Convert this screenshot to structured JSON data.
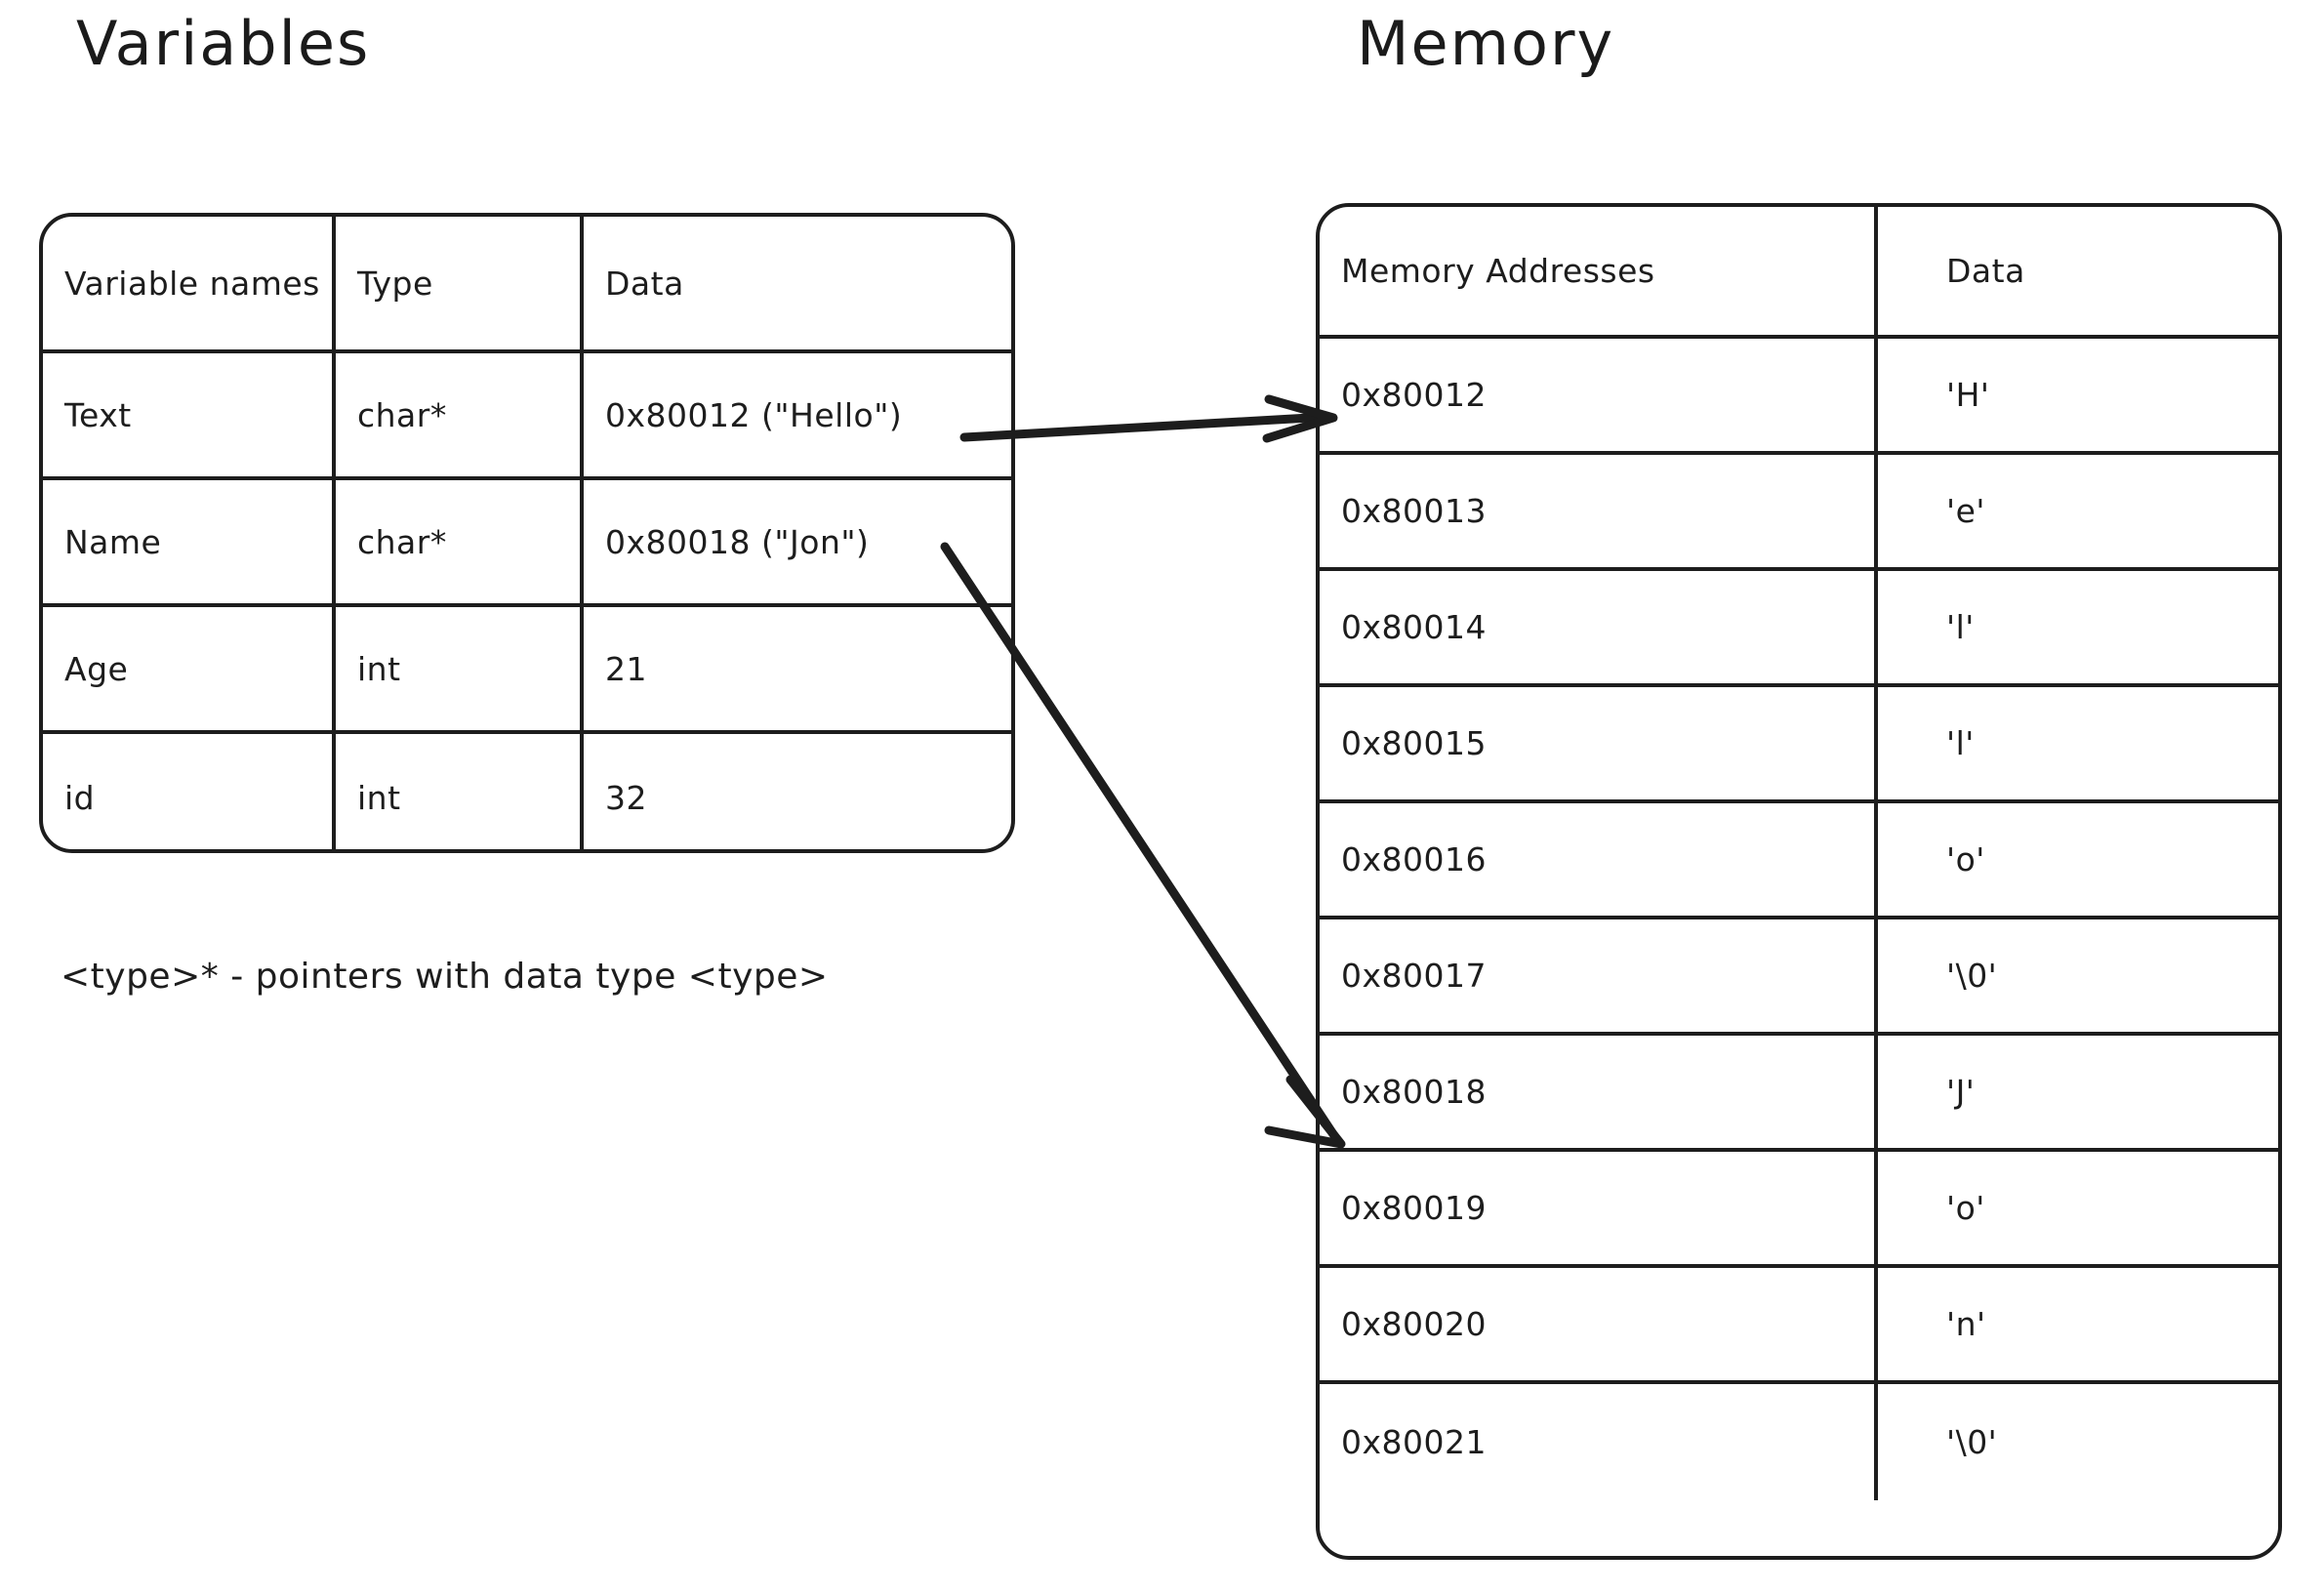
{
  "sections": {
    "variables_title": "Variables",
    "memory_title": "Memory"
  },
  "variables_table": {
    "headers": {
      "name": "Variable names",
      "type": "Type",
      "data": "Data"
    },
    "rows": [
      {
        "name": "Text",
        "type": "char*",
        "data": "0x80012 (\"Hello\")"
      },
      {
        "name": "Name",
        "type": "char*",
        "data": "0x80018 (\"Jon\")"
      },
      {
        "name": "Age",
        "type": "int",
        "data": "21"
      },
      {
        "name": "id",
        "type": "int",
        "data": "32"
      }
    ]
  },
  "memory_table": {
    "headers": {
      "address": "Memory Addresses",
      "data": "Data"
    },
    "rows": [
      {
        "address": "0x80012",
        "data": "'H'"
      },
      {
        "address": "0x80013",
        "data": "'e'"
      },
      {
        "address": "0x80014",
        "data": "'l'"
      },
      {
        "address": "0x80015",
        "data": "'l'"
      },
      {
        "address": "0x80016",
        "data": "'o'"
      },
      {
        "address": "0x80017",
        "data": "'\\0'"
      },
      {
        "address": "0x80018",
        "data": "'J'"
      },
      {
        "address": "0x80019",
        "data": "'o'"
      },
      {
        "address": "0x80020",
        "data": "'n'"
      },
      {
        "address": "0x80021",
        "data": "'\\0'"
      }
    ]
  },
  "footnote": {
    "text": "<type>* - pointers with data type <type>"
  },
  "arrows": [
    {
      "name": "text-pointer-arrow",
      "from": "variables.Text.data",
      "to": "memory.0x80012"
    },
    {
      "name": "name-pointer-arrow",
      "from": "variables.Name.data",
      "to": "memory.0x80018"
    }
  ],
  "colors": {
    "stroke": "#1d1d1d",
    "background": "#ffffff"
  }
}
